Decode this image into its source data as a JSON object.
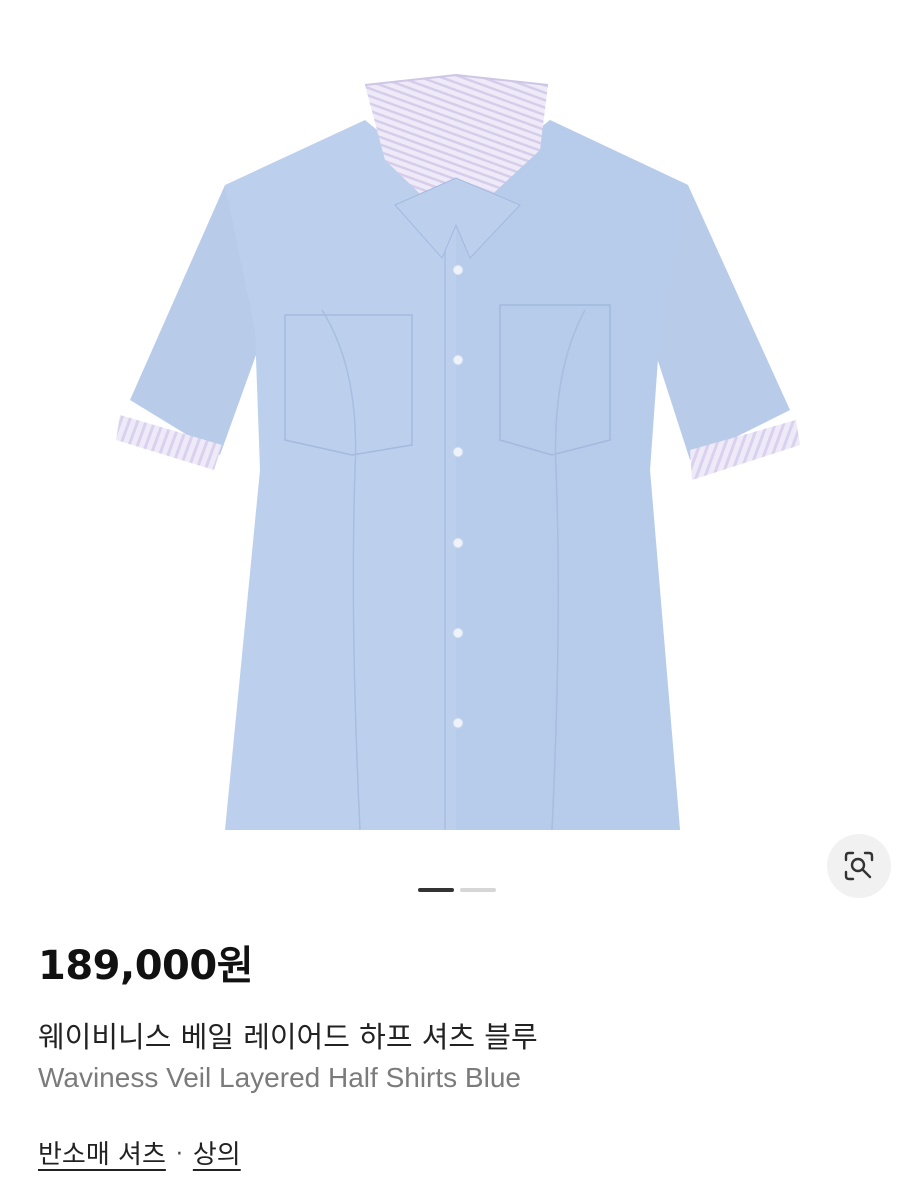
{
  "product": {
    "price": "189,000원",
    "name_ko": "웨이비니스 베일 레이어드 하프 셔츠 블루",
    "name_en": "Waviness Veil Layered Half Shirts Blue"
  },
  "gallery": {
    "image_alt": "웨이비니스 베일 레이어드 하프 셔츠 블루",
    "total_images": 2,
    "active_index": 1,
    "lens_icon": "visual-search-icon"
  },
  "breadcrumb": {
    "category_1": "반소매 셔츠",
    "separator": "·",
    "category_2": "상의"
  },
  "colors": {
    "shirt": "#b9cdeb",
    "stripe": "#e6e0f3",
    "pager_active": "#333333",
    "pager_inactive": "#d6d6d6"
  }
}
